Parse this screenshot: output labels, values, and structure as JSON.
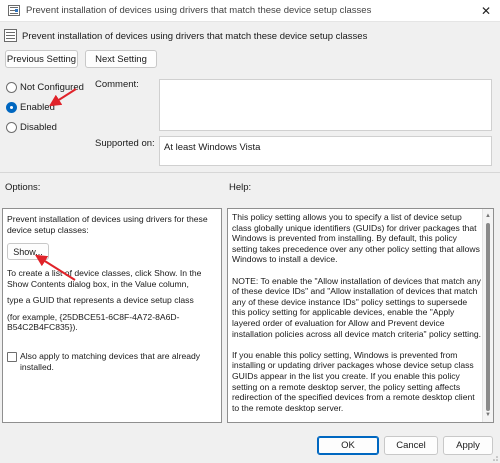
{
  "window": {
    "title": "Prevent installation of devices using drivers that match these device setup classes",
    "close_glyph": "✕"
  },
  "header": {
    "title": "Prevent installation of devices using drivers that match these device setup classes"
  },
  "nav": {
    "previous_label": "Previous Setting",
    "next_label": "Next Setting"
  },
  "state": {
    "options": [
      {
        "label": "Not Configured",
        "checked": false
      },
      {
        "label": "Enabled",
        "checked": true
      },
      {
        "label": "Disabled",
        "checked": false
      }
    ]
  },
  "comment": {
    "label": "Comment:",
    "value": ""
  },
  "supported": {
    "label": "Supported on:",
    "value": "At least Windows Vista"
  },
  "options_section": {
    "label": "Options:",
    "description": "Prevent installation of devices using drivers for these device setup classes:",
    "show_button": "Show...",
    "instructions": "To create a list of device classes, click Show. In the Show Contents dialog box, in the Value column,",
    "guid_hint": "type a GUID that represents a device setup class",
    "example": "(for example, {25DBCE51-6C8F-4A72-8A6D-B54C2B4FC835}).",
    "checkbox_label": "Also apply to matching devices that are already installed.",
    "checkbox_checked": false
  },
  "help_section": {
    "label": "Help:",
    "paragraphs": [
      "This policy setting allows you to specify a list of device setup class globally unique identifiers (GUIDs) for driver packages that Windows is prevented from installing. By default, this policy setting takes precedence over any other policy setting that allows Windows to install a device.",
      "NOTE: To enable the \"Allow installation of devices that match any of these device IDs\" and \"Allow installation of devices that match any of these device instance IDs\" policy settings to supersede this policy setting for applicable devices, enable the \"Apply layered order of evaluation for Allow and Prevent device installation policies across all device match criteria\" policy setting.",
      "If you enable this policy setting, Windows is prevented from installing or updating driver packages whose device setup class GUIDs appear in the list you create. If you enable this policy setting on a remote desktop server, the policy setting affects redirection of the specified devices from a remote desktop client to the remote desktop server."
    ]
  },
  "footer": {
    "ok_label": "OK",
    "cancel_label": "Cancel",
    "apply_label": "Apply"
  },
  "icons": {
    "app": "policy-icon",
    "close": "close-icon",
    "scroll_up": "scroll-up-icon",
    "scroll_down": "scroll-down-icon",
    "annotation_arrow": "red-arrow-icon"
  },
  "colors": {
    "accent": "#0067c0",
    "annotation": "#e0232a"
  }
}
